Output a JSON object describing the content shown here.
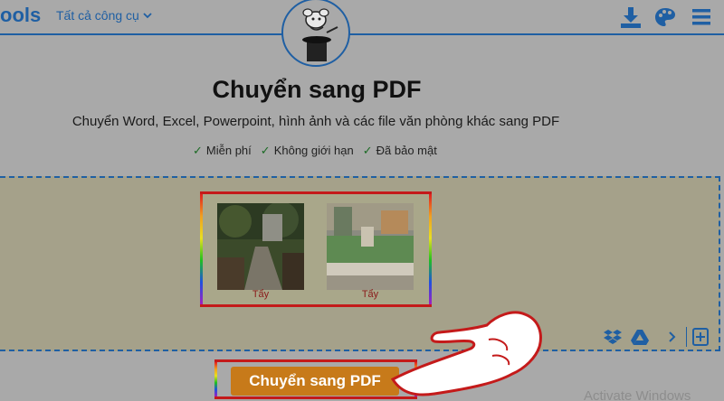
{
  "header": {
    "brand": "ools",
    "tools_menu_label": "Tất cả công cụ",
    "icons": [
      "download-icon",
      "palette-icon",
      "menu-icon"
    ]
  },
  "main": {
    "title": "Chuyển sang PDF",
    "subtitle": "Chuyển Word, Excel, Powerpoint, hình ảnh và các file văn phòng khác sang PDF",
    "features": [
      "Miễn phí",
      "Không giới hạn",
      "Đã bảo mật"
    ]
  },
  "dropzone": {
    "files": [
      {
        "remove_label": "Tẩy"
      },
      {
        "remove_label": "Tẩy"
      }
    ],
    "tool_icons": [
      "dropbox-icon",
      "google-drive-icon",
      "chevron-right-icon",
      "add-file-icon"
    ]
  },
  "convert_button_label": "Chuyển sang PDF",
  "watermark": "Activate Windows",
  "colors": {
    "brand_blue": "#1f5fa3",
    "button_orange": "#c77a1a",
    "highlight_red": "#c41a1a"
  }
}
